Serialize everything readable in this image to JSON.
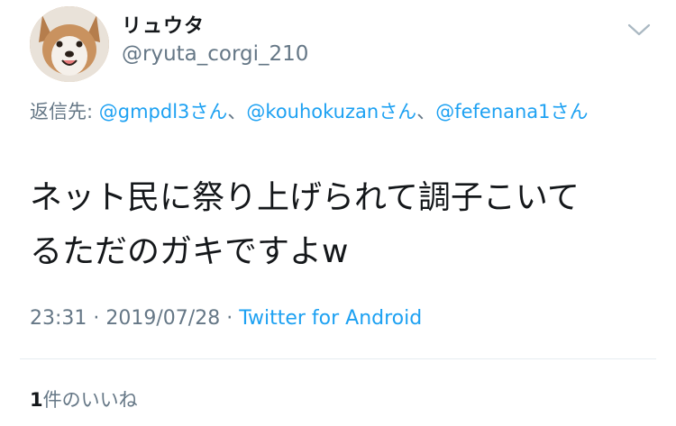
{
  "user": {
    "display_name": "リュウタ",
    "handle": "@ryuta_corgi_210"
  },
  "reply": {
    "label": "返信先: ",
    "mentions": [
      "@gmpdl3",
      "@kouhokuzan",
      "@fefenana1"
    ],
    "suffix_san": "さん",
    "separator": "、",
    "wrap_tail": "ん"
  },
  "tweet": {
    "line1": "ネット民に祭り上げられて調子こいて",
    "line2": "るただのガキですよw"
  },
  "meta": {
    "time": "23:31",
    "dot": " · ",
    "date": "2019/07/28",
    "client": "Twitter for Android"
  },
  "likes": {
    "count": "1",
    "label": "件のいいね"
  },
  "colors": {
    "link": "#1da1f2",
    "muted": "#657786",
    "text": "#14171a"
  },
  "icons": {
    "caret": "chevron-down-icon"
  }
}
